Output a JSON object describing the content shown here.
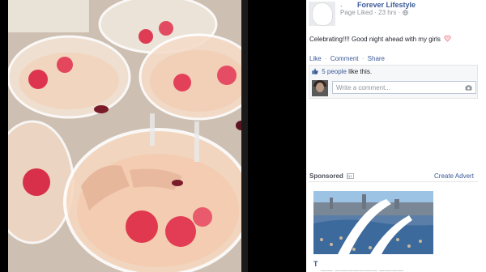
{
  "post": {
    "page_name": "Forever Lifestyle",
    "page_prefix": ".",
    "meta": "Page Liked · 23 hrs ·",
    "status_text": "Celebrating!!!! Good night ahead with my girls",
    "actions": {
      "like": "Like",
      "comment": "Comment",
      "share": "Share",
      "separator": "·"
    },
    "likes": {
      "count_link": "5 people",
      "suffix": " like this."
    },
    "comment_placeholder": "Write a comment..."
  },
  "sidebar": {
    "sponsored_label": "Sponsored",
    "create_advert": "Create Advert",
    "ad_title": "T",
    "ad_subtitle": "—— ——————— ————"
  },
  "colors": {
    "link": "#3b5998",
    "heart": "#e8828f",
    "background": "#000000"
  },
  "icons": [
    "heart-icon",
    "thumbs-up-icon",
    "camera-icon",
    "globe-icon",
    "ad-choices-icon"
  ]
}
